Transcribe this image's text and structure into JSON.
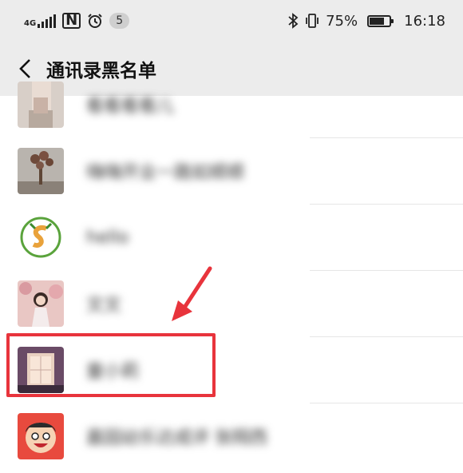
{
  "status_bar": {
    "network_type": "4G",
    "notification_count": "5",
    "battery_percent": "75%",
    "battery_level": 0.75,
    "time": "16:18"
  },
  "nav": {
    "title": "通讯录黑名单",
    "back_icon": "chevron-left-icon"
  },
  "contacts": [
    {
      "name": "看看看看儿"
    },
    {
      "name": "嗨嗨开业一路如顺顺"
    },
    {
      "name": "hello"
    },
    {
      "name": "文文"
    },
    {
      "name": "童小莉"
    },
    {
      "name": "嘉园幼乐达成评 张翔西"
    }
  ],
  "colors": {
    "bar_background": "#ececec",
    "highlight_red": "#e8343c",
    "arrow_red": "#e8343c"
  }
}
